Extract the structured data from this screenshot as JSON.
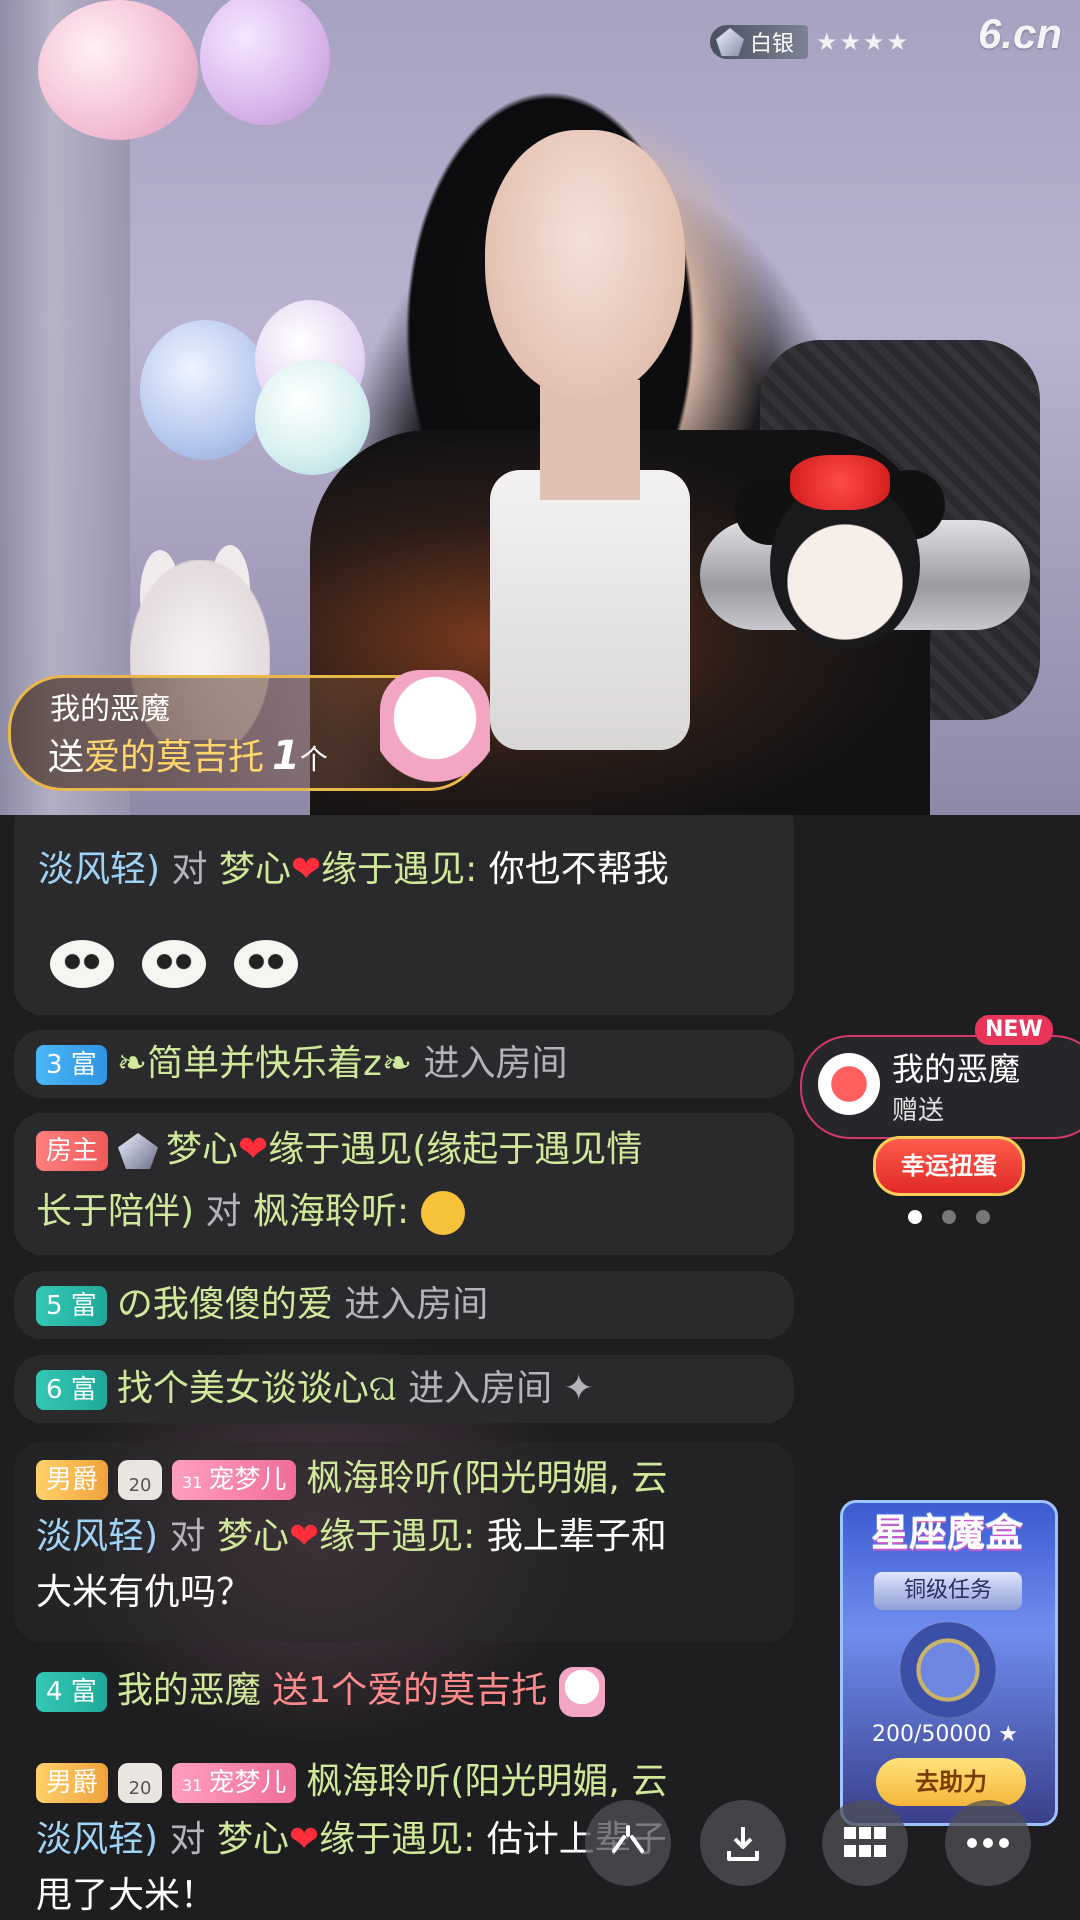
{
  "stream": {
    "rank_label": "白银",
    "stars": "★★★★",
    "site_logo": "6.cn"
  },
  "gift_banner": {
    "user": "我的恶魔",
    "prefix": "送",
    "gift_name": "爱的莫吉托",
    "count": "1",
    "unit": "个"
  },
  "chat": {
    "msg1": {
      "from": "淡风轻)",
      "to_word": "对",
      "target": "梦心",
      "target_suffix": "缘于遇见:",
      "text": "你也不帮我"
    },
    "msg2": {
      "tag": "3 富",
      "user": "❧简单并快乐着z❧",
      "action": "进入房间"
    },
    "msg3": {
      "tag": "房主",
      "user": "梦心",
      "user_suffix": "缘于遇见(缘起于遇见情",
      "line2_prefix": "长于陪伴)",
      "to_word": "对",
      "target": "枫海聆听:"
    },
    "msg4": {
      "tag": "5 富",
      "user": "の我傻傻的爱",
      "action": "进入房间"
    },
    "msg5": {
      "tag": "6 富",
      "user": "找个美女谈谈心ଘ",
      "action": "进入房间"
    },
    "msg6": {
      "tag": "男爵",
      "guard_level": "20",
      "pet_level": "31",
      "pet_name": "宠梦儿",
      "user": "枫海聆听(阳光明媚, 云",
      "line2_prefix": "淡风轻)",
      "to_word": "对",
      "target": "梦心",
      "target_suffix": "缘于遇见:",
      "text": "我上辈子和",
      "line3": "大米有仇吗？"
    },
    "msg7": {
      "tag": "4 富",
      "user": "我的恶魔",
      "action": "送1个爱的莫吉托"
    },
    "msg8": {
      "tag": "男爵",
      "guard_level": "20",
      "pet_level": "31",
      "pet_name": "宠梦儿",
      "user": "枫海聆听(阳光明媚, 云",
      "line2_prefix": "淡风轻)",
      "to_word": "对",
      "target": "梦心",
      "target_suffix": "缘于遇见:",
      "text": "估计上辈子",
      "line3": "甩了大米！"
    }
  },
  "side": {
    "new_tag": "NEW",
    "notif_name": "我的恶魔",
    "notif_action": "赠送",
    "lucky_button": "幸运扭蛋",
    "zodiac_title": "星座魔盒",
    "zodiac_task": "铜级任务",
    "zodiac_progress": "200/50000 ★",
    "zodiac_button": "去助力"
  },
  "colors": {
    "chat_bg": "#1e1e20",
    "bubble_bg": "#2a2a2c",
    "name_blue": "#9fd3f6",
    "name_green": "#cfe89a",
    "heart_red": "#ff2e3a",
    "gift_gold": "#ffd66b"
  }
}
